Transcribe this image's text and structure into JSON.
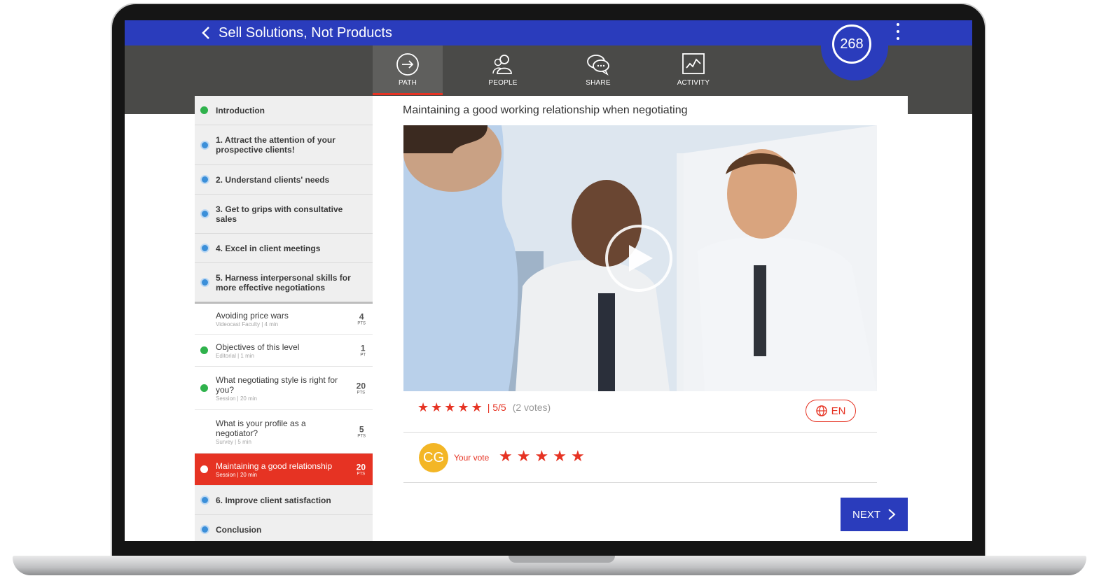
{
  "header": {
    "back_title": "Sell Solutions, Not Products",
    "score": "268"
  },
  "tabs": [
    {
      "label": "PATH",
      "icon": "arrow-circle-icon",
      "active": true
    },
    {
      "label": "PEOPLE",
      "icon": "people-icon",
      "active": false
    },
    {
      "label": "SHARE",
      "icon": "chat-bubbles-icon",
      "active": false
    },
    {
      "label": "ACTIVITY",
      "icon": "activity-chart-icon",
      "active": false
    }
  ],
  "sidebar": {
    "chapters_top": [
      {
        "label": "Introduction",
        "status": "done"
      },
      {
        "label": "1. Attract the attention of your prospective clients!",
        "status": "progress"
      },
      {
        "label": "2. Understand clients' needs",
        "status": "progress"
      },
      {
        "label": "3. Get to grips with consultative sales",
        "status": "progress"
      },
      {
        "label": "4. Excel in client meetings",
        "status": "progress"
      },
      {
        "label": "5. Harness interpersonal skills for more effective negotiations",
        "status": "progress"
      }
    ],
    "lessons": [
      {
        "title": "Avoiding price wars",
        "sub": "Videocast Faculty | 4 min",
        "points": "4",
        "unit": "PTS",
        "status": "none"
      },
      {
        "title": "Objectives of this level",
        "sub": "Editorial | 1 min",
        "points": "1",
        "unit": "PT",
        "status": "done"
      },
      {
        "title": "What negotiating style is right for you?",
        "sub": "Session | 20 min",
        "points": "20",
        "unit": "PTS",
        "status": "done"
      },
      {
        "title": "What is your profile as a negotiator?",
        "sub": "Survey | 5 min",
        "points": "5",
        "unit": "PTS",
        "status": "none"
      },
      {
        "title": "Maintaining a good relationship",
        "sub": "Session | 20 min",
        "points": "20",
        "unit": "PTS",
        "status": "active"
      }
    ],
    "chapters_bottom": [
      {
        "label": "6. Improve client satisfaction",
        "status": "progress"
      },
      {
        "label": "Conclusion",
        "status": "progress"
      }
    ]
  },
  "main": {
    "title": "Maintaining a good working relationship when negotiating",
    "rating": {
      "stars": 5,
      "value": "5/5",
      "votes": "(2 votes)"
    },
    "language": "EN",
    "user": {
      "initials": "CG",
      "vote_label": "Your vote",
      "vote_stars": 5
    },
    "next_label": "NEXT"
  },
  "colors": {
    "brand_blue": "#2a3cbc",
    "accent_red": "#e63323",
    "done_green": "#2fb24c",
    "tabbar_gray": "#4a4a48"
  }
}
